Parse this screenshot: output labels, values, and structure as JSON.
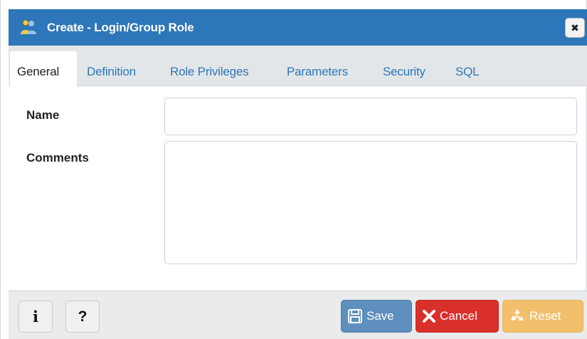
{
  "dialog": {
    "title": "Create - Login/Group Role",
    "close_glyph": "✖",
    "title_icon": "login-group-role-icon"
  },
  "tabs": [
    {
      "label": "General",
      "active": true
    },
    {
      "label": "Definition",
      "active": false
    },
    {
      "label": "Role Privileges",
      "active": false
    },
    {
      "label": "Parameters",
      "active": false
    },
    {
      "label": "Security",
      "active": false
    },
    {
      "label": "SQL",
      "active": false
    }
  ],
  "form": {
    "name_label": "Name",
    "name_value": "",
    "comments_label": "Comments",
    "comments_value": ""
  },
  "footer": {
    "info_glyph": "i",
    "help_glyph": "?",
    "save_label": "Save",
    "cancel_label": "Cancel",
    "reset_label": "Reset"
  },
  "colors": {
    "titlebar": "#2c76b9",
    "tab_link": "#2c76b9",
    "save": "#5e8fbd",
    "cancel": "#d9302c",
    "reset": "#f2c06d"
  }
}
